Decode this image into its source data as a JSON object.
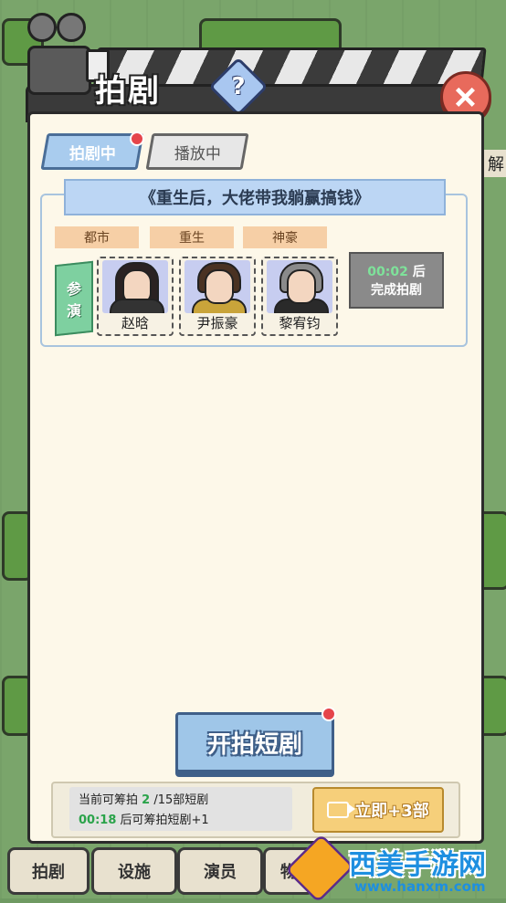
{
  "header": {
    "title": "拍剧",
    "help_symbol": "?",
    "close_symbol": "+"
  },
  "tabs": [
    {
      "label": "拍剧中",
      "active": true
    },
    {
      "label": "播放中",
      "active": false
    }
  ],
  "drama": {
    "title": "《重生后，大佬带我躺赢搞钱》",
    "genres": [
      "都市",
      "重生",
      "神豪"
    ],
    "cast_tag": [
      "参",
      "演"
    ],
    "actors": [
      {
        "name": "赵晗",
        "hair": "#2a2222",
        "outfit": "#333333"
      },
      {
        "name": "尹振豪",
        "hair": "#4a3222",
        "outfit": "#c9a43a"
      },
      {
        "name": "黎宥钧",
        "hair": "#8a8a8a",
        "outfit": "#2a2a2a"
      }
    ],
    "timer": {
      "time": "00:02",
      "suffix": "后",
      "label": "完成拍剧"
    }
  },
  "start_button": {
    "label": "开拍短剧"
  },
  "quota": {
    "prefix": "当前可筹拍",
    "count": "2",
    "suffix": "/15部短剧",
    "time": "00:18",
    "time_suffix": "后可筹拍短剧+1"
  },
  "instant_button": {
    "label": "立即+3部"
  },
  "bottom_nav": [
    "拍剧",
    "设施",
    "演员",
    "物"
  ],
  "side_text": "解",
  "watermark": {
    "text": "西美手游网",
    "url": "www.hanxm.com"
  },
  "colors": {
    "accent_blue": "#9fc6e8",
    "panel": "#fdf8e9",
    "green_text": "#2aa34a",
    "gold": "#f6cf7a"
  }
}
